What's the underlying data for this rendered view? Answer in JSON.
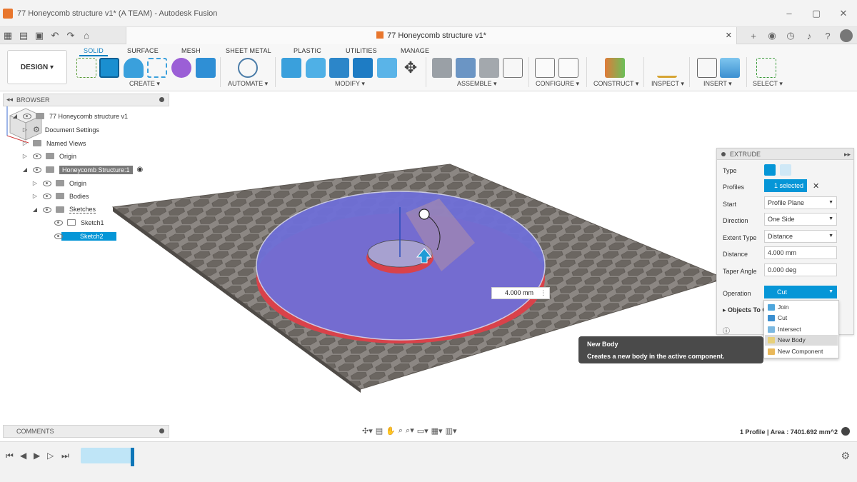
{
  "window": {
    "title": "77 Honeycomb structure v1* (A TEAM) - Autodesk Fusion",
    "controls": [
      "–",
      "▢",
      "✕"
    ]
  },
  "doc_tab": {
    "title": "77 Honeycomb structure v1*",
    "close": "✕"
  },
  "ribbon": {
    "workspace": "DESIGN ▾",
    "tabs": [
      "SOLID",
      "SURFACE",
      "MESH",
      "SHEET METAL",
      "PLASTIC",
      "UTILITIES",
      "MANAGE"
    ],
    "groups": {
      "create": "CREATE ▾",
      "automate": "AUTOMATE ▾",
      "modify": "MODIFY ▾",
      "assemble": "ASSEMBLE ▾",
      "configure": "CONFIGURE ▾",
      "construct": "CONSTRUCT ▾",
      "inspect": "INSPECT ▾",
      "insert": "INSERT ▾",
      "select": "SELECT ▾"
    }
  },
  "browser": {
    "header": "BROWSER",
    "items": {
      "root": "77 Honeycomb structure v1",
      "doc_settings": "Document Settings",
      "named_views": "Named Views",
      "origin": "Origin",
      "component": "Honeycomb Structure:1",
      "comp_origin": "Origin",
      "bodies": "Bodies",
      "sketches": "Sketches",
      "sketch1": "Sketch1",
      "sketch2": "Sketch2"
    }
  },
  "comments": {
    "label": "COMMENTS"
  },
  "extrude": {
    "header": "EXTRUDE",
    "labels": {
      "type": "Type",
      "profiles": "Profiles",
      "start": "Start",
      "direction": "Direction",
      "extent_type": "Extent Type",
      "distance": "Distance",
      "taper_angle": "Taper Angle",
      "operation": "Operation",
      "objects_to_cut": "Objects To C"
    },
    "values": {
      "profiles": "1 selected",
      "start": "Profile Plane",
      "direction": "One Side",
      "extent_type": "Distance",
      "distance": "4.000 mm",
      "taper_angle": "0.000 deg",
      "operation": "Cut"
    },
    "operation_options": [
      "Join",
      "Cut",
      "Intersect",
      "New Body",
      "New Component"
    ]
  },
  "tooltip": {
    "title": "New Body",
    "text": "Creates a new body in the active component."
  },
  "viewport": {
    "distance_input": "4.000 mm"
  },
  "status": {
    "text": "1 Profile | Area : 7401.692 mm^2"
  },
  "colors": {
    "accent": "#0696d7",
    "cut_red": "#d9424a",
    "profile_blue": "#6f6fd8",
    "hex_body": "#6b6661"
  }
}
